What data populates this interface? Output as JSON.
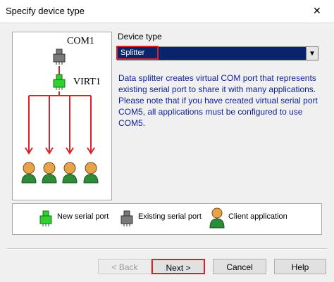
{
  "window": {
    "title": "Specify device type",
    "close_glyph": "✕"
  },
  "diagram": {
    "com_label": "COM1",
    "virt_label": "VIRT1"
  },
  "device_type": {
    "label": "Device type",
    "selected": "Splitter",
    "highlight_color": "#d8232a",
    "selection_color": "#0a246a"
  },
  "description": "Data splitter creates virtual COM port that represents existing serial port to share it with many applications. Please note that if you have created virtual serial port COM5, all applications must be configured to use COM5.",
  "legend": {
    "new_port": "New serial port",
    "existing_port": "Existing serial port",
    "client": "Client application"
  },
  "buttons": {
    "back": "< Back",
    "next": "Next >",
    "cancel": "Cancel",
    "help": "Help"
  },
  "colors": {
    "arrow": "#d8232a",
    "new_port": "#2fd12f",
    "existing_port": "#7a7a7a",
    "client_body": "#2e8b3a",
    "client_head": "#e8a34a"
  }
}
